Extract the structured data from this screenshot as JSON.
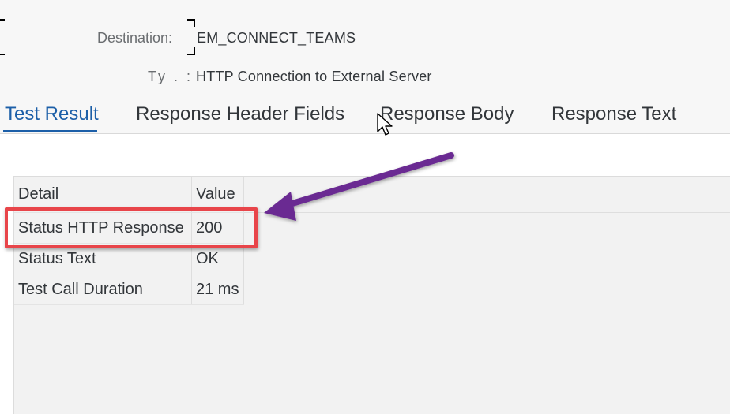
{
  "header": {
    "destination_label": "Destination:",
    "destination_value": "EM_CONNECT_TEAMS",
    "type_label": "Ty . :",
    "type_value": "HTTP Connection to External Server"
  },
  "tabs": [
    {
      "label": "Test Result",
      "active": true
    },
    {
      "label": "Response Header Fields",
      "active": false
    },
    {
      "label": "Response Body",
      "active": false
    },
    {
      "label": "Response Text",
      "active": false
    }
  ],
  "results_table": {
    "columns": [
      "Detail",
      "Value"
    ],
    "rows": [
      {
        "detail": "Status HTTP Response",
        "value": "200"
      },
      {
        "detail": "Status Text",
        "value": "OK"
      },
      {
        "detail": "Test Call Duration",
        "value": "21 ms"
      }
    ]
  },
  "annotation": {
    "highlight_color": "#e8454a",
    "arrow_color": "#6a2a92"
  },
  "colors": {
    "active_tab": "#1c5fa8",
    "text": "#32363a",
    "label": "#6a6d70"
  },
  "icons": {
    "cursor": "mouse-pointer-icon"
  }
}
